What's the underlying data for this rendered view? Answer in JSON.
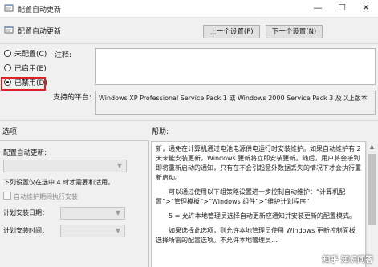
{
  "window": {
    "title": "配置自动更新",
    "minimize": "—",
    "maximize": "☐",
    "close": "✕"
  },
  "header": {
    "title": "配置自动更新",
    "prev_button": "上一个设置(P)",
    "next_button": "下一个设置(N)"
  },
  "state": {
    "options": [
      {
        "label": "未配置(C)",
        "selected": false
      },
      {
        "label": "已启用(E)",
        "selected": false
      },
      {
        "label": "已禁用(D)",
        "selected": true
      }
    ]
  },
  "comment": {
    "label": "注释:",
    "value": ""
  },
  "platform": {
    "label": "支持的平台:",
    "value": "Windows XP Professional Service Pack 1 或 Windows 2000 Service Pack 3 及以上版本"
  },
  "sections": {
    "options": "选项:",
    "help": "帮助:"
  },
  "options_panel": {
    "configure_label": "配置自动更新:",
    "note": "下列设置仅在选中 4 时才需要和适用。",
    "install_during_maintenance": "自动维护期间执行安装",
    "schedule_day_label": "计划安装日期：",
    "schedule_time_label": "计划安装时间："
  },
  "help": {
    "paragraphs": [
      "新，通免在计算机通过电池电源供电运行时安装维护。如果自动维护有 2 天未能安装更新，Windows 更新将立即安装更新。随后，用户将会接到即将重新启动的通知，只有在不会引起意外数据丢失的情况下才会执行重新启动。",
      "可以通过使用以下组策略设置进一步控制自动维护：“计算机配置”>“管理模板”>“Windows 组件”>“维护计划程序”",
      "5 = 允许本地管理员选择自动更新应通知并安装更新的配置模式。",
      "如果选择此选项，则允许本地管理员使用 Windows 更新控制面板选择所需的配置选项。不允许本地管理员..."
    ]
  },
  "watermark": "知乎 知识问答"
}
